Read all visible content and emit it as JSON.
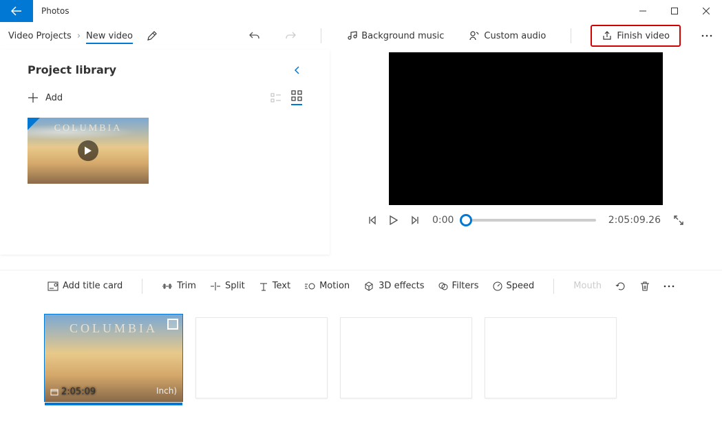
{
  "app": {
    "title": "Photos"
  },
  "breadcrumb": {
    "root": "Video Projects",
    "current": "New video"
  },
  "header": {
    "bg_music": "Background music",
    "custom_audio": "Custom audio",
    "finish": "Finish video"
  },
  "library": {
    "title": "Project library",
    "add": "Add",
    "thumb_label": "COLUMBIA"
  },
  "player": {
    "current": "0:00",
    "total": "2:05:09.26"
  },
  "toolbar": {
    "title_card": "Add title card",
    "trim": "Trim",
    "split": "Split",
    "text": "Text",
    "motion": "Motion",
    "fx3d": "3D effects",
    "filters": "Filters",
    "speed": "Speed",
    "mouth": "Mouth"
  },
  "storyboard": {
    "clip_label": "COLUMBIA",
    "clip_duration": "2:05:09",
    "clip_note": "Inch)"
  }
}
